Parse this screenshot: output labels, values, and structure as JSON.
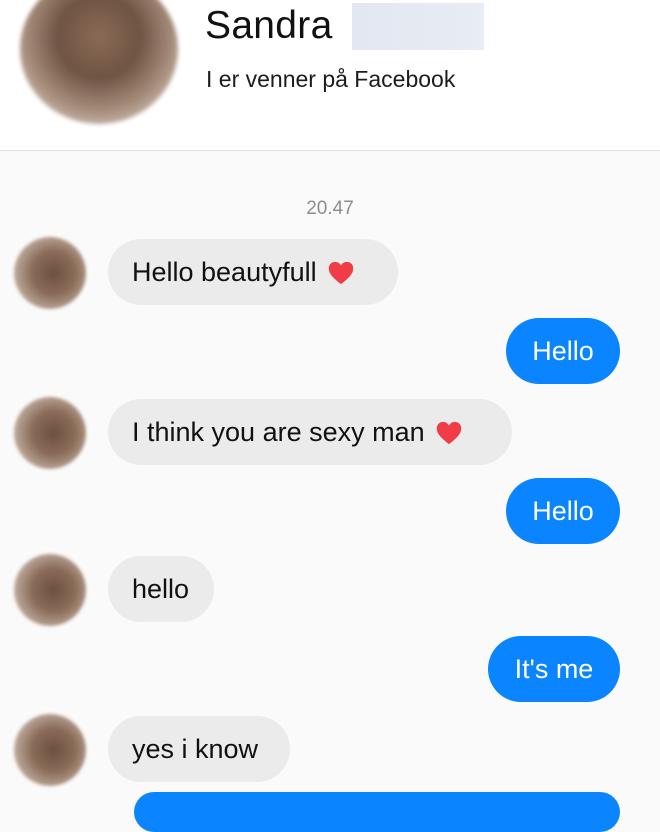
{
  "header": {
    "name": "Sandra",
    "subtitle": "I er venner på Facebook"
  },
  "conversation": {
    "timestamp": "20.47",
    "messages": [
      {
        "direction": "incoming",
        "text": "Hello beautyfull",
        "emoji": "heart-icon"
      },
      {
        "direction": "outgoing",
        "text": "Hello"
      },
      {
        "direction": "incoming",
        "text": "I think you are sexy man",
        "emoji": "heart-icon"
      },
      {
        "direction": "outgoing",
        "text": "Hello"
      },
      {
        "direction": "incoming",
        "text": "hello"
      },
      {
        "direction": "outgoing",
        "text": "It's me"
      },
      {
        "direction": "incoming",
        "text": "yes i know"
      }
    ]
  },
  "colors": {
    "outgoing_bubble": "#0a84ff",
    "incoming_bubble": "#ebebeb",
    "heart": "#f03c46"
  }
}
